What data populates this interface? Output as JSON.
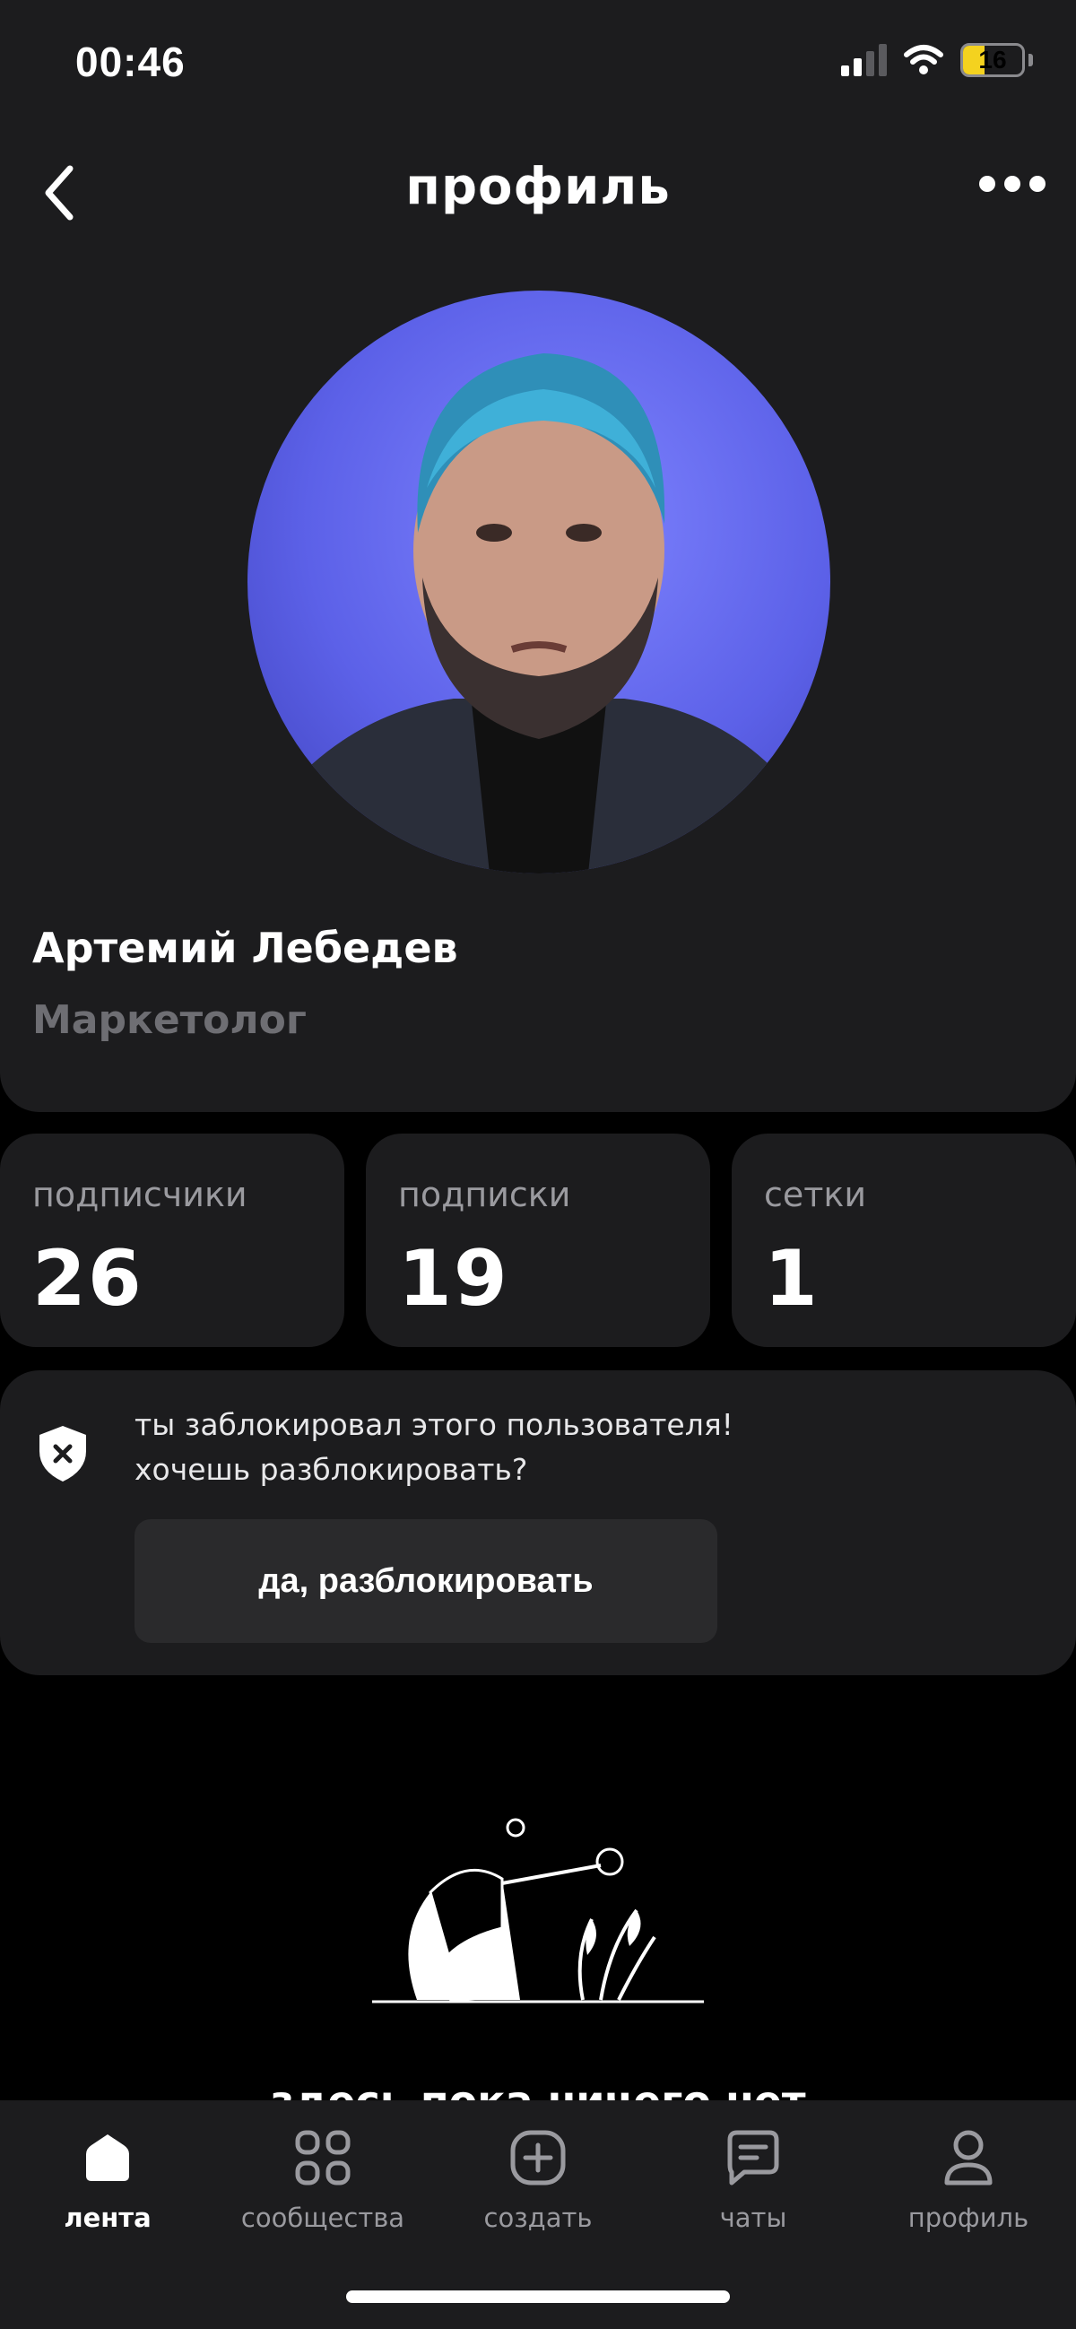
{
  "status_bar": {
    "time": "00:46",
    "battery": "16"
  },
  "header": {
    "title": "профиль"
  },
  "profile": {
    "name": "Артемий Лебедев",
    "role": "Маркетолог"
  },
  "stats": [
    {
      "label": "подписчики",
      "value": "26"
    },
    {
      "label": "подписки",
      "value": "19"
    },
    {
      "label": "сетки",
      "value": "1"
    }
  ],
  "blocked": {
    "line1": "ты заблокировал этого пользователя!",
    "line2": "хочешь разблокировать?",
    "button": "да, разблокировать"
  },
  "empty_state": {
    "text": "здесь пока ничего нет"
  },
  "tabs": [
    {
      "label": "лента",
      "icon": "home-icon",
      "active": true
    },
    {
      "label": "сообщества",
      "icon": "grid-icon",
      "active": false
    },
    {
      "label": "создать",
      "icon": "plus-square-icon",
      "active": false
    },
    {
      "label": "чаты",
      "icon": "chat-icon",
      "active": false
    },
    {
      "label": "профиль",
      "icon": "user-icon",
      "active": false
    }
  ],
  "colors": {
    "panel": "#1c1c1e",
    "muted": "#9a9a9f",
    "avatar_bg": "#5c61e8",
    "battery": "#f4d21f"
  }
}
